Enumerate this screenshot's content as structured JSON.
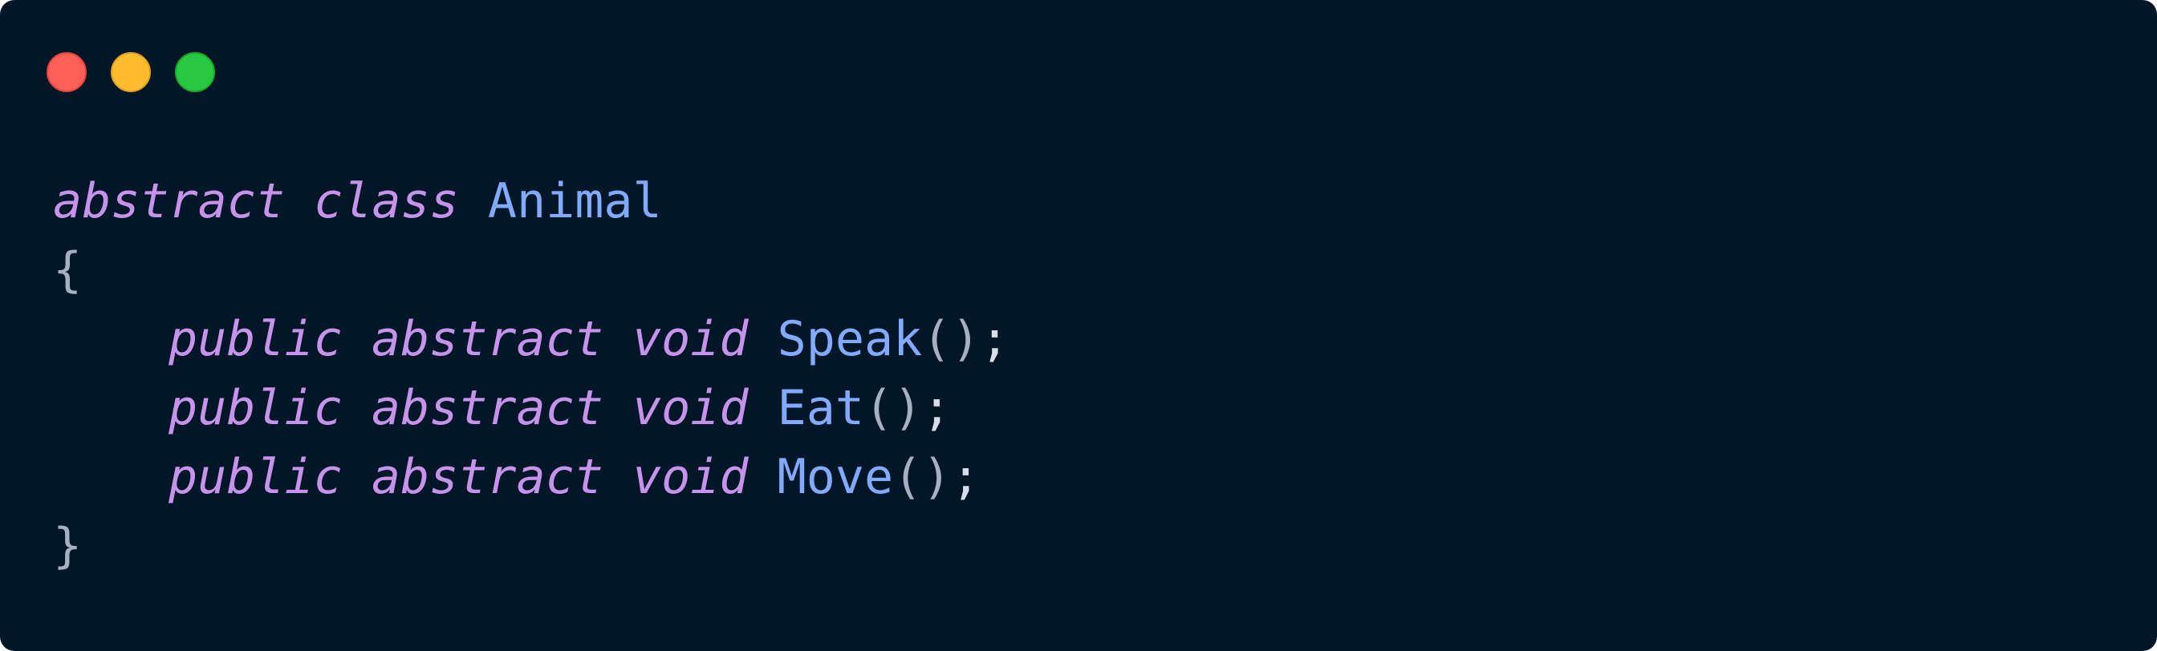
{
  "window": {
    "background": "#011627",
    "controls": {
      "close_color": "#ff5f57",
      "minimize_color": "#febc2e",
      "maximize_color": "#28c840"
    }
  },
  "code": {
    "language": "csharp",
    "colors": {
      "keyword": "#c792ea",
      "identifier": "#82aaff",
      "punctuation": "#a5b0c2"
    },
    "lines": [
      {
        "kw1": "abstract",
        "kw2": "class",
        "name": "Animal"
      },
      {
        "text": "{"
      },
      {
        "kw1": "public",
        "kw2": "abstract",
        "kw3": "void",
        "name": "Speak",
        "paren_open": "(",
        "paren_close": ")",
        "semi": ";"
      },
      {
        "kw1": "public",
        "kw2": "abstract",
        "kw3": "void",
        "name": "Eat",
        "paren_open": "(",
        "paren_close": ")",
        "semi": ";"
      },
      {
        "kw1": "public",
        "kw2": "abstract",
        "kw3": "void",
        "name": "Move",
        "paren_open": "(",
        "paren_close": ")",
        "semi": ";"
      },
      {
        "text": "}"
      }
    ]
  }
}
